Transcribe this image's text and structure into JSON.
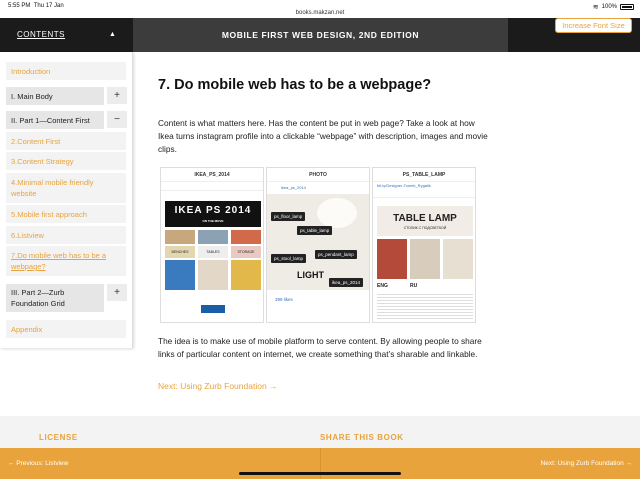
{
  "statusbar": {
    "time": "5:55 PM",
    "date": "Thu 17 Jan",
    "url": "books.makzan.net",
    "battery": "100%"
  },
  "header": {
    "contents_label": "CONTENTS",
    "book_title": "MOBILE FIRST WEB DESIGN, 2ND EDITION",
    "font_button": "Increase Font Size"
  },
  "sidebar": {
    "items": [
      {
        "label": "Introduction"
      },
      {
        "label": "I. Main Body",
        "toggle": "+"
      },
      {
        "label": "II. Part 1—Content First",
        "toggle": "−"
      },
      {
        "label": "2.Content First"
      },
      {
        "label": "3.Content Strategy"
      },
      {
        "label": "4.Minimal mobile friendly website"
      },
      {
        "label": "5.Mobile first approach"
      },
      {
        "label": "6.Listview"
      },
      {
        "label": "7.Do mobile web has to be a webpage?"
      },
      {
        "label": "III. Part 2—Zurb Foundation Grid",
        "toggle": "+"
      },
      {
        "label": "Appendix"
      }
    ]
  },
  "article": {
    "title": "7. Do mobile web has to be a webpage?",
    "para1": "Content is what matters here. Has the content be put in web page? Take a look at how Ikea turns instagram profile into a clickable “webpage” with description, images and movie clips.",
    "para2": "The idea is to make use of mobile platform to serve content. By allowing people to share links of particular content on internet, we create something that’s sharable and linkable.",
    "next_link": "Next: Using Zurb Foundation →",
    "screens": {
      "left": {
        "header": "IKEA_PS_2014",
        "banner": "IKEA PS 2014",
        "banner_sub": "ON THE MOVE",
        "label1": "BENCHES",
        "label2": "TABLES",
        "label3": "STORAGE"
      },
      "middle": {
        "header": "PHOTO",
        "user": "ikea_ps_2014",
        "tags": [
          "ps_floor_lamp",
          "ps_table_lamp",
          "ps_stool_lamp",
          "ps_pendant_lamp",
          "ikea_ps_2014"
        ],
        "big": "LIGHT",
        "likes": "399 likes"
      },
      "right": {
        "header": "PS_TABLE_LAMP",
        "link": "bit.ly/Designer-Tomek_Rygalik",
        "big": "TABLE LAMP",
        "big_sub": "СТОЛИК С ПОДСВЕТКОЙ",
        "eng": "ENG",
        "ru": "RU"
      }
    }
  },
  "footer": {
    "license": "LICENSE",
    "share": "SHARE THIS BOOK",
    "prev": "←  Previous: Listview",
    "next": "Next: Using Zurb Foundation  →"
  },
  "colors": {
    "accent": "#e8a33d",
    "topbar": "#3c3c3c",
    "dark": "#1b1b1b"
  }
}
